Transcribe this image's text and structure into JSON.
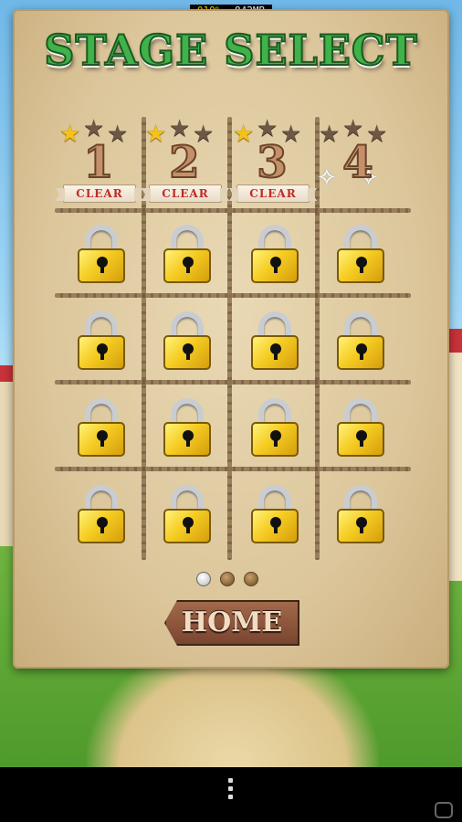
{
  "status": {
    "battery_pct": "010%",
    "memory": "842MB"
  },
  "title": "STAGE SELECT",
  "stages": [
    {
      "number": "1",
      "stars_earned": 1,
      "stars_total": 3,
      "cleared": true,
      "clear_label": "CLEAR"
    },
    {
      "number": "2",
      "stars_earned": 1,
      "stars_total": 3,
      "cleared": true,
      "clear_label": "CLEAR"
    },
    {
      "number": "3",
      "stars_earned": 1,
      "stars_total": 3,
      "cleared": true,
      "clear_label": "CLEAR"
    },
    {
      "number": "4",
      "stars_earned": 0,
      "stars_total": 3,
      "cleared": false,
      "current": true
    }
  ],
  "locked_stage_count": 16,
  "pagination": {
    "pages": 3,
    "current_page": 1
  },
  "home_label": "HOME",
  "icons": {
    "star": "star-icon",
    "lock": "padlock-icon",
    "wings": "wings-icon",
    "menu": "overflow-menu-icon"
  },
  "colors": {
    "title_green": "#3fb24a",
    "star_gold": "#f4c21a",
    "lock_gold": "#f5cc22",
    "clear_red": "#c02b24"
  }
}
